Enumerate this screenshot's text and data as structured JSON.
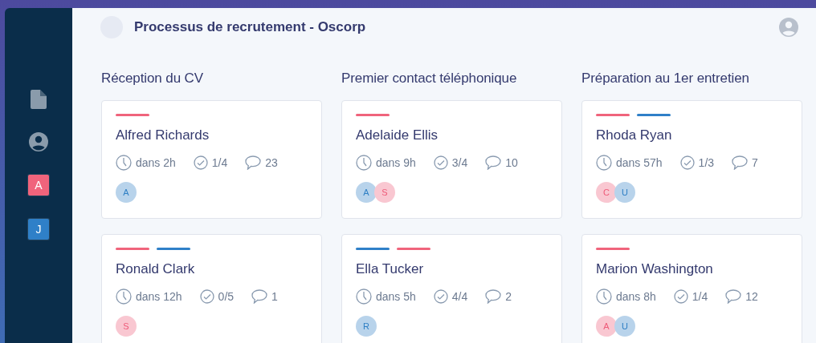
{
  "header": {
    "title": "Processus de recrutement - Oscorp"
  },
  "sidebar": {
    "items": [
      {
        "kind": "file"
      },
      {
        "kind": "user"
      },
      {
        "kind": "badge",
        "label": "A",
        "color": "#f0647c"
      },
      {
        "kind": "badge",
        "label": "J",
        "color": "#2f80c8"
      }
    ]
  },
  "columns": [
    {
      "title": "Réception du CV",
      "cards": [
        {
          "name": "Alfred Richards",
          "tags": [
            {
              "color": "#f0647c"
            }
          ],
          "due": "dans 2h",
          "tasks": "1/4",
          "comments": "23",
          "avatars": [
            {
              "letter": "A",
              "color": "#2f7fc4"
            }
          ]
        },
        {
          "name": "Ronald Clark",
          "tags": [
            {
              "color": "#f0647c"
            },
            {
              "color": "#2f80c8"
            }
          ],
          "due": "dans 12h",
          "tasks": "0/5",
          "comments": "1",
          "avatars": [
            {
              "letter": "S",
              "color": "#ee5a78"
            }
          ]
        }
      ]
    },
    {
      "title": "Premier contact téléphonique",
      "cards": [
        {
          "name": "Adelaide Ellis",
          "tags": [
            {
              "color": "#f0647c"
            }
          ],
          "due": "dans 9h",
          "tasks": "3/4",
          "comments": "10",
          "avatars": [
            {
              "letter": "A",
              "color": "#2f7fc4"
            },
            {
              "letter": "S",
              "color": "#ee5a78"
            }
          ]
        },
        {
          "name": "Ella Tucker",
          "tags": [
            {
              "color": "#2f80c8"
            },
            {
              "color": "#f0647c"
            }
          ],
          "due": "dans 5h",
          "tasks": "4/4",
          "comments": "2",
          "avatars": [
            {
              "letter": "R",
              "color": "#2f7fc4"
            }
          ]
        }
      ]
    },
    {
      "title": "Préparation au 1er entretien",
      "cards": [
        {
          "name": "Rhoda Ryan",
          "tags": [
            {
              "color": "#f0647c"
            },
            {
              "color": "#2f80c8"
            }
          ],
          "due": "dans 57h",
          "tasks": "1/3",
          "comments": "7",
          "avatars": [
            {
              "letter": "C",
              "color": "#ee5a78"
            },
            {
              "letter": "U",
              "color": "#2f7fc4"
            }
          ]
        },
        {
          "name": "Marion Washington",
          "tags": [
            {
              "color": "#f0647c"
            }
          ],
          "due": "dans 8h",
          "tasks": "1/4",
          "comments": "12",
          "avatars": [
            {
              "letter": "A",
              "color": "#ee5a78"
            },
            {
              "letter": "U",
              "color": "#2f7fc4"
            }
          ]
        }
      ]
    }
  ]
}
